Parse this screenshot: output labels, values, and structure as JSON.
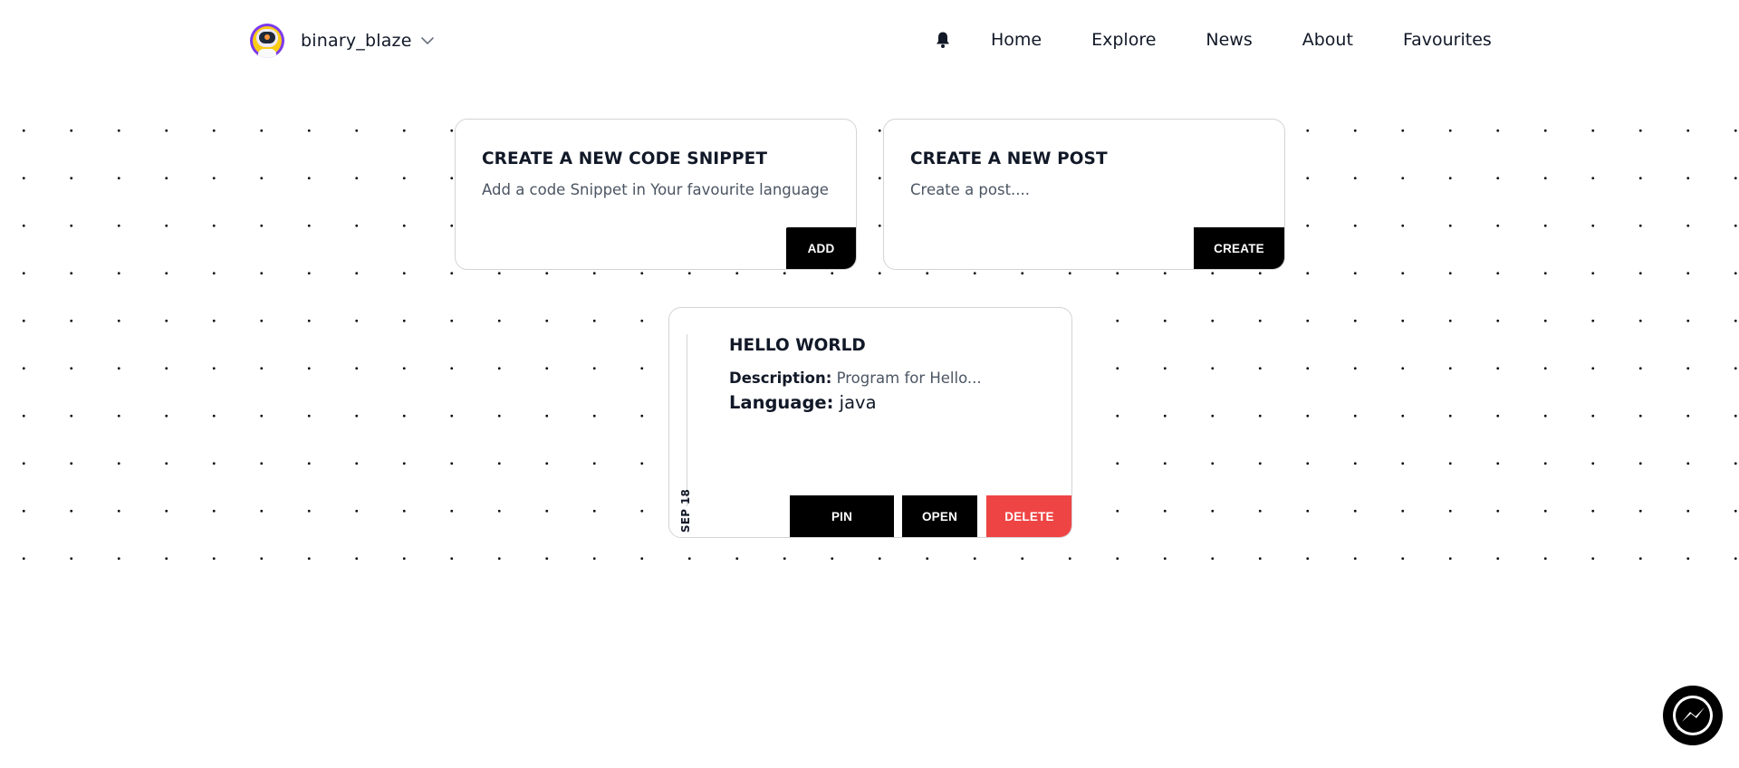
{
  "header": {
    "username": "binary_blaze",
    "nav": {
      "home": "Home",
      "explore": "Explore",
      "news": "News",
      "about": "About",
      "favourites": "Favourites"
    },
    "icons": [
      "avatar",
      "chevron-down-icon",
      "bell-icon"
    ]
  },
  "cards": {
    "snippet_create": {
      "title": "CREATE A NEW CODE SNIPPET",
      "description": "Add a code Snippet in Your favourite language",
      "button": "ADD"
    },
    "post_create": {
      "title": "CREATE A NEW POST",
      "description": "Create a post....",
      "button": "CREATE"
    }
  },
  "snippet": {
    "date": "SEP 18",
    "title": "HELLO WORLD",
    "description_label": "Description:",
    "description_value": "Program for Hello...",
    "language_label": "Language:",
    "language_value": "java",
    "buttons": {
      "pin": "PIN",
      "open": "OPEN",
      "delete": "DELETE"
    }
  },
  "colors": {
    "primary_button": "#000000",
    "danger_button": "#ef4444",
    "text": "#111827",
    "muted_text": "#4b5563",
    "card_border": "#d4d4d8"
  },
  "widgets": {
    "chat_icon": "messenger-icon"
  }
}
